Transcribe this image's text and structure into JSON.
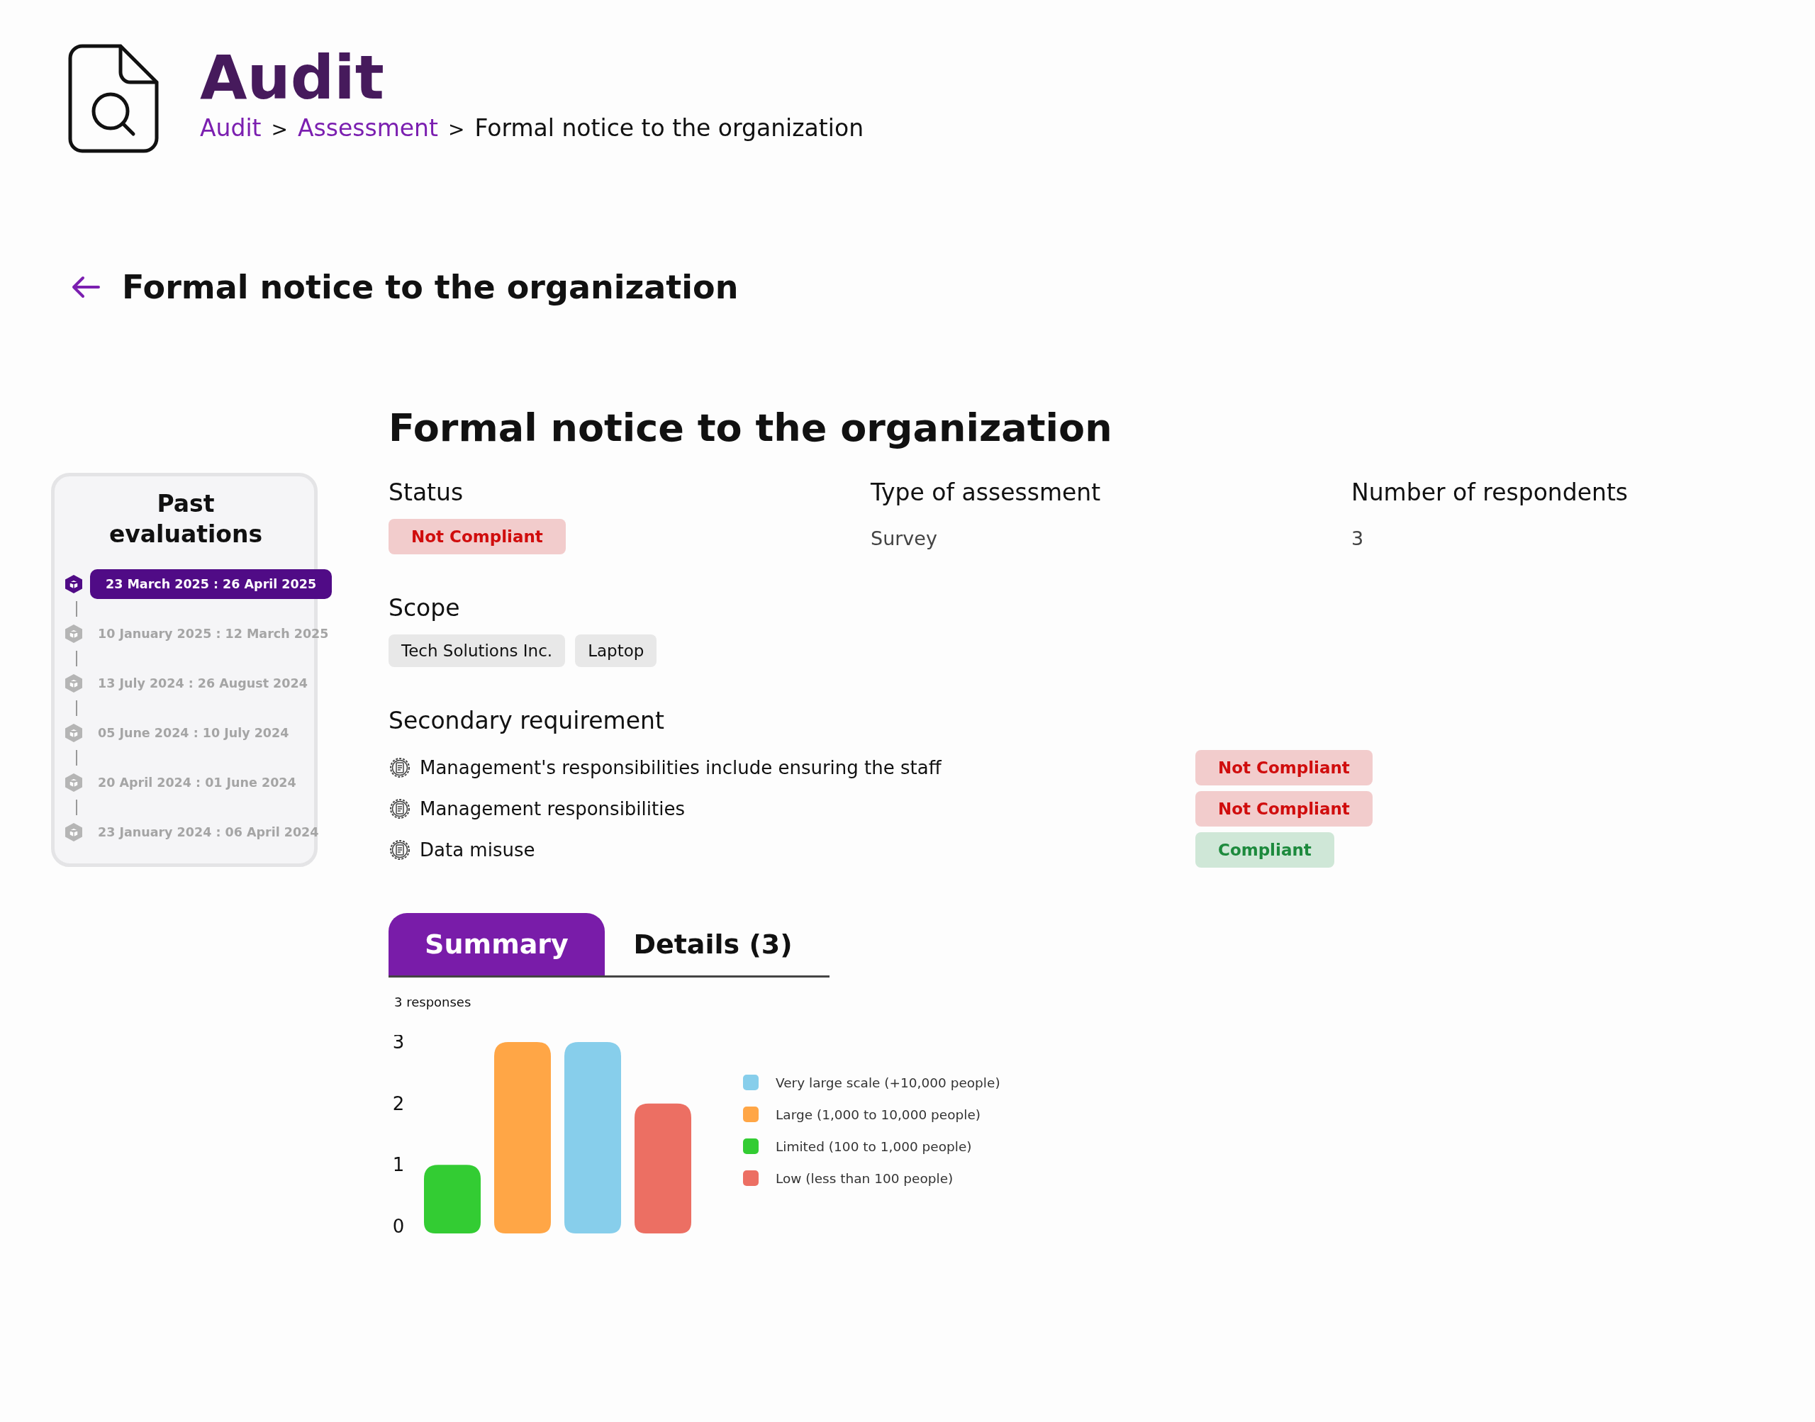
{
  "header": {
    "title": "Audit",
    "breadcrumb": [
      {
        "label": "Audit",
        "link": true
      },
      {
        "label": "Assessment",
        "link": true
      },
      {
        "label": "Formal notice to the organization",
        "link": false
      }
    ],
    "separator": ">"
  },
  "back_heading": "Formal notice to the organization",
  "sidebar": {
    "title": "Past evaluations",
    "items": [
      {
        "label": "23 March 2025 : 26 April 2025",
        "selected": true
      },
      {
        "label": "10 January 2025 : 12 March 2025",
        "selected": false
      },
      {
        "label": "13 July 2024 : 26 August 2024",
        "selected": false
      },
      {
        "label": "05 June 2024 : 10 July 2024",
        "selected": false
      },
      {
        "label": "20 April 2024 : 01 June 2024",
        "selected": false
      },
      {
        "label": "23 January 2024 : 06 April 2024",
        "selected": false
      }
    ]
  },
  "main": {
    "title": "Formal notice to the organization",
    "fields": [
      {
        "label": "Status",
        "kind": "badge",
        "value": "Not Compliant",
        "compliant": false
      },
      {
        "label": "Type of assessment",
        "kind": "text",
        "value": "Survey"
      },
      {
        "label": "Number of respondents",
        "kind": "text",
        "value": "3"
      }
    ],
    "scope": {
      "label": "Scope",
      "tags": [
        "Tech Solutions Inc.",
        "Laptop"
      ]
    },
    "secondary": {
      "label": "Secondary requirement",
      "items": [
        {
          "text": "Management's responsibilities include ensuring the staff",
          "status": "Not Compliant",
          "compliant": false
        },
        {
          "text": "Management responsibilities",
          "status": "Not Compliant",
          "compliant": false
        },
        {
          "text": "Data misuse",
          "status": "Compliant",
          "compliant": true
        }
      ]
    },
    "tabs": [
      {
        "label": "Summary",
        "selected": true
      },
      {
        "label": "Details (3)",
        "selected": false
      }
    ],
    "responses": "3 responses",
    "chart_data": {
      "type": "bar",
      "stacked": true,
      "ylim": [
        0,
        3
      ],
      "yticks": [
        0,
        1,
        2,
        3
      ],
      "series": [
        {
          "name": "Very large scale (+10,000 people)",
          "color": "#87ceeb",
          "values": [
            null,
            null,
            3,
            null
          ]
        },
        {
          "name": "Large (1,000 to 10,000 people)",
          "color": "#ffa646",
          "values": [
            null,
            3,
            null,
            null
          ]
        },
        {
          "name": "Limited (100 to 1,000 people)",
          "color": "#33cc33",
          "values": [
            1,
            null,
            null,
            null
          ]
        },
        {
          "name": "Low (less than 100 people)",
          "color": "#ec6f63",
          "values": [
            null,
            null,
            null,
            2
          ]
        }
      ]
    }
  }
}
